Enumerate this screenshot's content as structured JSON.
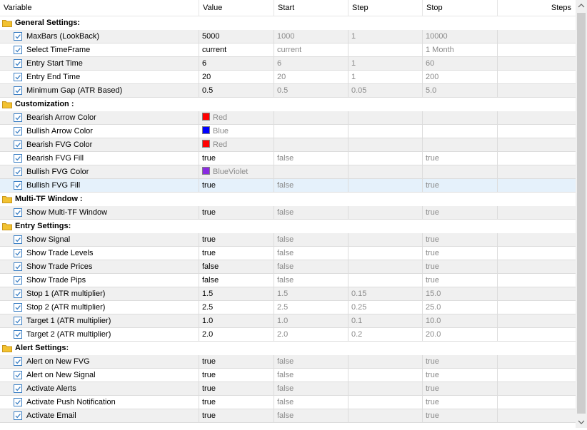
{
  "header": {
    "variable": "Variable",
    "value": "Value",
    "start": "Start",
    "step": "Step",
    "stop": "Stop",
    "steps": "Steps"
  },
  "rows": [
    {
      "type": "group",
      "label": "General Settings:"
    },
    {
      "type": "param",
      "label": "MaxBars (LookBack)",
      "value": "5000",
      "start": "1000",
      "step": "1",
      "stop": "10000"
    },
    {
      "type": "param",
      "label": "Select TimeFrame",
      "value": "current",
      "start": "current",
      "step": "",
      "stop": "1 Month"
    },
    {
      "type": "param",
      "label": "Entry Start Time",
      "value": "6",
      "start": "6",
      "step": "1",
      "stop": "60"
    },
    {
      "type": "param",
      "label": "Entry End Time",
      "value": "20",
      "start": "20",
      "step": "1",
      "stop": "200"
    },
    {
      "type": "param",
      "label": "Minimum Gap (ATR Based)",
      "value": "0.5",
      "start": "0.5",
      "step": "0.05",
      "stop": "5.0"
    },
    {
      "type": "group",
      "label": "Customization :"
    },
    {
      "type": "color",
      "label": "Bearish Arrow Color",
      "value": "Red",
      "color": "#ff0000"
    },
    {
      "type": "color",
      "label": "Bullish Arrow Color",
      "value": "Blue",
      "color": "#0000ff"
    },
    {
      "type": "color",
      "label": "Bearish FVG Color",
      "value": "Red",
      "color": "#ff0000"
    },
    {
      "type": "param",
      "label": "Bearish FVG Fill",
      "value": "true",
      "start": "false",
      "step": "",
      "stop": "true"
    },
    {
      "type": "color",
      "label": "Bullish FVG Color",
      "value": "BlueViolet",
      "color": "#8a2be2"
    },
    {
      "type": "param",
      "label": "Bullish FVG Fill",
      "value": "true",
      "start": "false",
      "step": "",
      "stop": "true",
      "selected": true
    },
    {
      "type": "group",
      "label": "Multi-TF Window :"
    },
    {
      "type": "param",
      "label": "Show Multi-TF Window",
      "value": "true",
      "start": "false",
      "step": "",
      "stop": "true"
    },
    {
      "type": "group",
      "label": "Entry Settings:"
    },
    {
      "type": "param",
      "label": "Show Signal",
      "value": "true",
      "start": "false",
      "step": "",
      "stop": "true"
    },
    {
      "type": "param",
      "label": "Show Trade Levels",
      "value": "true",
      "start": "false",
      "step": "",
      "stop": "true"
    },
    {
      "type": "param",
      "label": "Show Trade Prices",
      "value": "false",
      "start": "false",
      "step": "",
      "stop": "true"
    },
    {
      "type": "param",
      "label": "Show Trade Pips",
      "value": "false",
      "start": "false",
      "step": "",
      "stop": "true"
    },
    {
      "type": "param",
      "label": "Stop 1 (ATR multiplier)",
      "value": "1.5",
      "start": "1.5",
      "step": "0.15",
      "stop": "15.0"
    },
    {
      "type": "param",
      "label": "Stop 2 (ATR multiplier)",
      "value": "2.5",
      "start": "2.5",
      "step": "0.25",
      "stop": "25.0"
    },
    {
      "type": "param",
      "label": "Target 1 (ATR multiplier)",
      "value": "1.0",
      "start": "1.0",
      "step": "0.1",
      "stop": "10.0"
    },
    {
      "type": "param",
      "label": "Target 2 (ATR multiplier)",
      "value": "2.0",
      "start": "2.0",
      "step": "0.2",
      "stop": "20.0"
    },
    {
      "type": "group",
      "label": "Alert Settings:"
    },
    {
      "type": "param",
      "label": "Alert on New FVG",
      "value": "true",
      "start": "false",
      "step": "",
      "stop": "true"
    },
    {
      "type": "param",
      "label": "Alert on New Signal",
      "value": "true",
      "start": "false",
      "step": "",
      "stop": "true"
    },
    {
      "type": "param",
      "label": "Activate Alerts",
      "value": "true",
      "start": "false",
      "step": "",
      "stop": "true"
    },
    {
      "type": "param",
      "label": "Activate Push Notification",
      "value": "true",
      "start": "false",
      "step": "",
      "stop": "true"
    },
    {
      "type": "param",
      "label": "Activate Email",
      "value": "true",
      "start": "false",
      "step": "",
      "stop": "true"
    }
  ],
  "icons": {
    "group": "folder-icon",
    "checkbox": "checkbox-checked-icon"
  },
  "colors": {
    "folder": "#f2c231",
    "checkbox_border": "#3b7fc4",
    "selected_row": "#e5f1fb"
  }
}
